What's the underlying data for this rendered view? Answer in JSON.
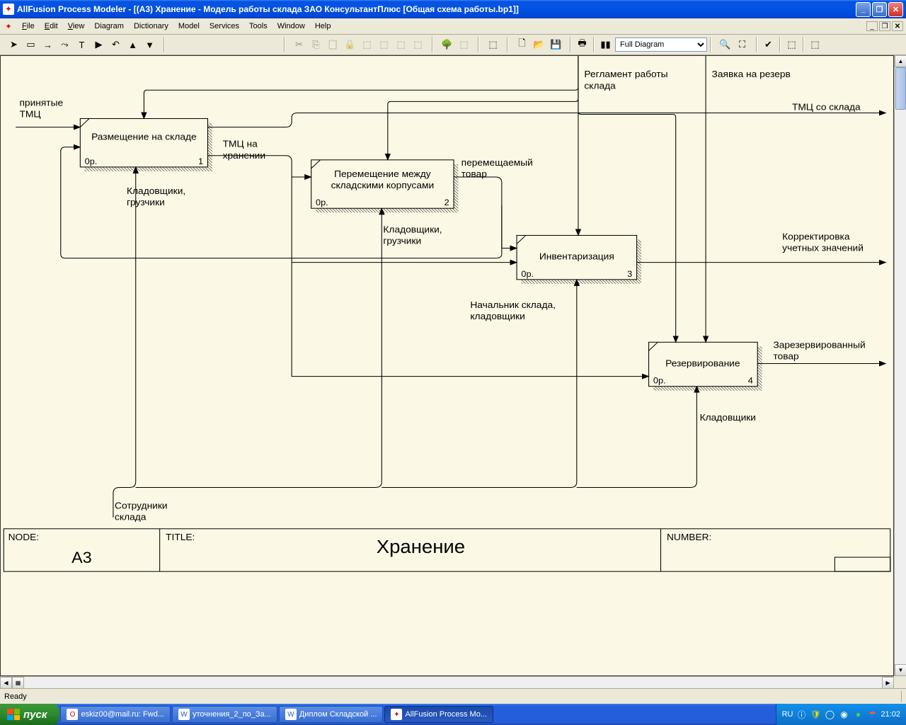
{
  "window": {
    "title": "AllFusion Process Modeler - [(A3) Хранение - Модель работы склада ЗАО КонсультантПлюс  [Общая схема работы.bp1]]"
  },
  "menu": {
    "file": "File",
    "edit": "Edit",
    "view": "View",
    "diagram": "Diagram",
    "dictionary": "Dictionary",
    "model": "Model",
    "services": "Services",
    "tools": "Tools",
    "window": "Window",
    "help": "Help"
  },
  "toolbar": {
    "view_select": "Full Diagram"
  },
  "diagram": {
    "inputs": {
      "tmc_in": "принятые\nТМЦ"
    },
    "controls": {
      "reglament": "Регламент работы\nсклада",
      "zayavka": "Заявка на резерв"
    },
    "outputs": {
      "tmc_out": "ТМЦ со склада",
      "korrekt": "Корректировка\nучетных значений",
      "zarezerv": "Зарезервированный\nтовар"
    },
    "mechanisms": {
      "sotrudniki": "Сотрудники\nсклада"
    },
    "boxes": {
      "b1": {
        "title": "Размещение на складе",
        "cost": "0р.",
        "num": "1",
        "out": "ТМЦ на\nхранении",
        "mech": "Кладовщики,\nгрузчики"
      },
      "b2": {
        "title": "Перемещение между\nскладскими корпусами",
        "cost": "0р.",
        "num": "2",
        "out": "перемещаемый\nтовар",
        "mech": "Кладовщики,\nгрузчики"
      },
      "b3": {
        "title": "Инвентаризация",
        "cost": "0р.",
        "num": "3",
        "mech": "Начальник склада,\nкладовщики"
      },
      "b4": {
        "title": "Резервирование",
        "cost": "0р.",
        "num": "4",
        "mech": "Кладовщики"
      }
    },
    "footer": {
      "node_label": "NODE:",
      "node_value": "A3",
      "title_label": "TITLE:",
      "title_value": "Хранение",
      "number_label": "NUMBER:"
    }
  },
  "status": {
    "ready": "Ready",
    "lang": "RU"
  },
  "taskbar": {
    "start": "пуск",
    "items": [
      "eskiz00@mail.ru: Fwd...",
      "уточнения_2_по_За...",
      "Диплом Складской ...",
      "AllFusion Process Mo..."
    ],
    "clock": "21:02"
  }
}
